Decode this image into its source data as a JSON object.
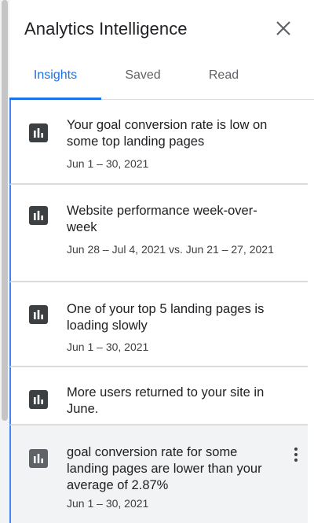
{
  "header": {
    "title": "Analytics Intelligence",
    "close_icon": "close-icon"
  },
  "tabs": [
    {
      "label": "Insights",
      "active": true
    },
    {
      "label": "Saved",
      "active": false
    },
    {
      "label": "Read",
      "active": false
    }
  ],
  "colors": {
    "accent": "#1a73e8",
    "card_border": "#4285f4",
    "highlight_bg": "#f1f3f4",
    "text": "#202124"
  },
  "insights": [
    {
      "icon": "bar-chart-icon",
      "title": "Your goal conversion rate is low on some top landing pages",
      "date": "Jun 1 – 30, 2021"
    },
    {
      "icon": "bar-chart-icon",
      "title": "Website performance week-over-week",
      "date": "Jun 28 – Jul 4, 2021 vs. Jun 21 – 27, 2021"
    },
    {
      "icon": "bar-chart-icon",
      "title": "One of your top 5 landing pages is loading slowly",
      "date": "Jun 1 – 30, 2021"
    },
    {
      "icon": "bar-chart-icon",
      "title": "More users returned to your site in June.",
      "date": ""
    },
    {
      "icon": "bar-chart-icon",
      "title": "goal conversion rate for some landing pages are lower than your average of 2.87%",
      "date": "Jun 1 – 30, 2021",
      "menu_icon": "more-vertical-icon"
    }
  ]
}
